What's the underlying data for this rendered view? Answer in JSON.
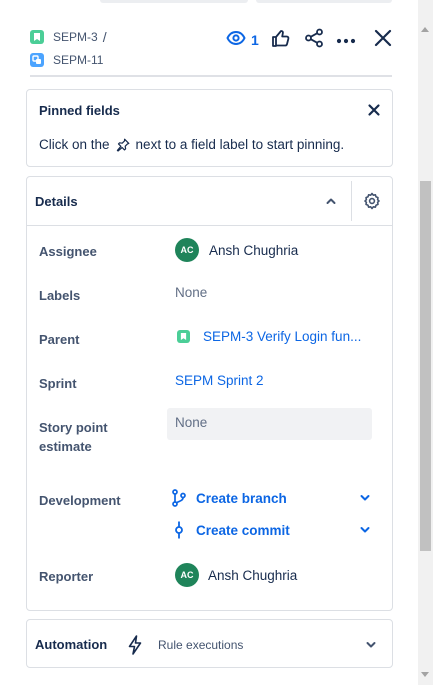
{
  "header": {
    "parent_key": "SEPM-3",
    "separator": "/",
    "issue_key": "SEPM-11",
    "watch_count": "1"
  },
  "pinned": {
    "title": "Pinned fields",
    "message_before": "Click on the",
    "message_after": "next to a field label to start pinning."
  },
  "details": {
    "title": "Details",
    "fields": {
      "assignee": {
        "label": "Assignee",
        "initials": "AC",
        "name": "Ansh Chughria"
      },
      "labels": {
        "label": "Labels",
        "value": "None"
      },
      "parent": {
        "label": "Parent",
        "value": "SEPM-3 Verify Login fun..."
      },
      "sprint": {
        "label": "Sprint",
        "value": "SEPM Sprint 2"
      },
      "story_points": {
        "label_line1": "Story point",
        "label_line2": "estimate",
        "value": "None"
      },
      "development": {
        "label": "Development",
        "create_branch": "Create branch",
        "create_commit": "Create commit"
      },
      "reporter": {
        "label": "Reporter",
        "initials": "AC",
        "name": "Ansh Chughria"
      }
    }
  },
  "automation": {
    "title": "Automation",
    "rules": "Rule executions"
  },
  "colors": {
    "link": "#0C66E4",
    "avatar": "#1F845A",
    "story": "#4BCE97",
    "subtask": "#4CA4FF"
  },
  "icons": [
    "story-icon",
    "subtask-icon",
    "eye-icon",
    "thumbs-up-icon",
    "share-icon",
    "more-icon",
    "close-icon",
    "pin-icon",
    "chevron-up-icon",
    "gear-icon",
    "branch-icon",
    "commit-icon",
    "chevron-down-icon",
    "bolt-icon"
  ]
}
